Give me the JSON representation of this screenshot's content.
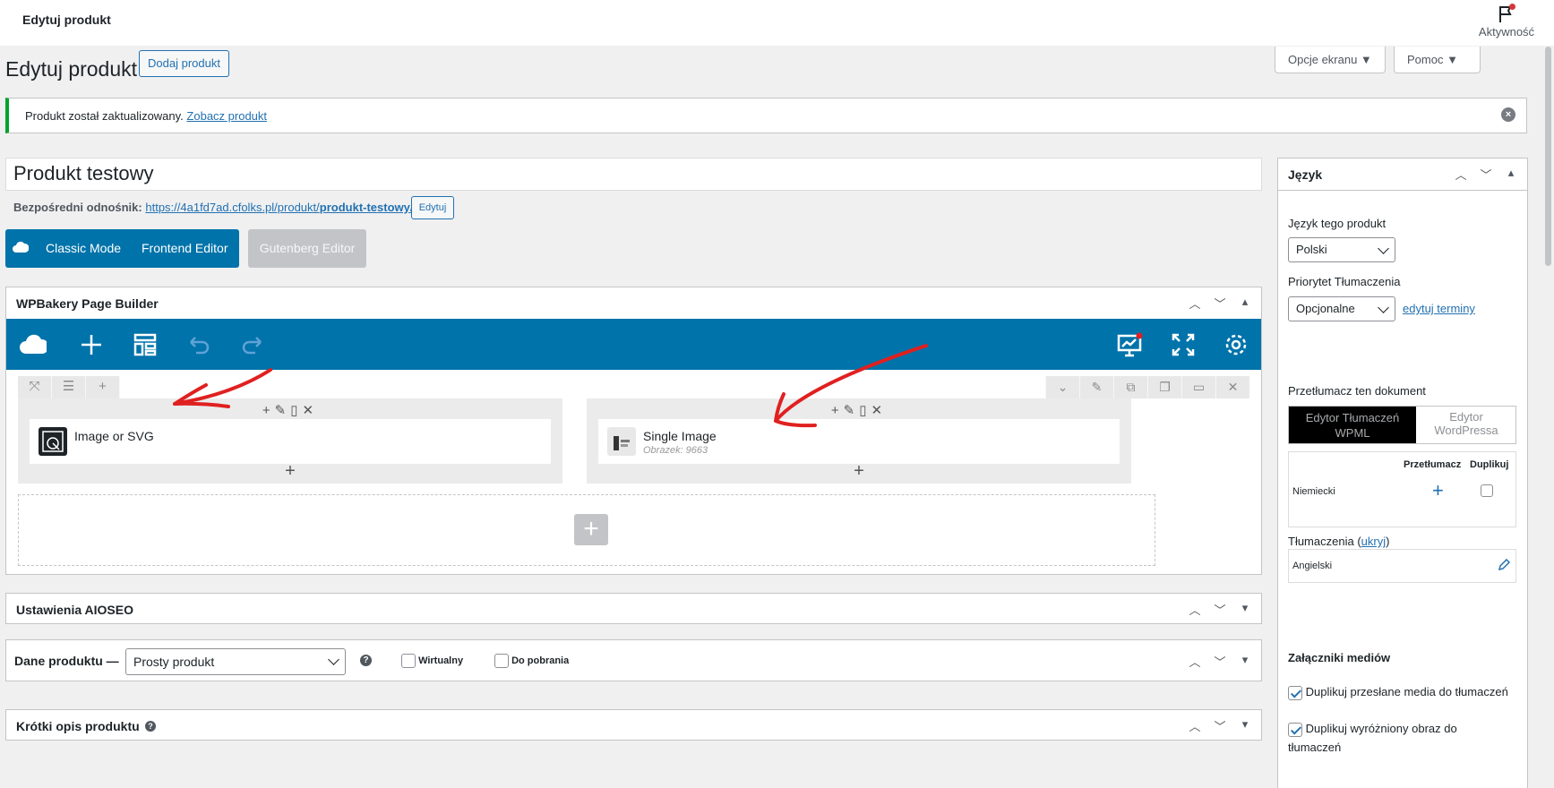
{
  "topbar": {
    "title": "Edytuj produkt",
    "activity_label": "Aktywność"
  },
  "header": {
    "title": "Edytuj produkt",
    "add_button": "Dodaj produkt",
    "screen_options": "Opcje ekranu ▼",
    "help": "Pomoc ▼"
  },
  "notice": {
    "text": "Produkt został zaktualizowany.",
    "link": "Zobacz produkt"
  },
  "post": {
    "title": "Produkt testowy",
    "permalink_label": "Bezpośredni odnośnik:",
    "permalink_base": "https://4a1fd7ad.cfolks.pl/produkt/",
    "permalink_slug": "produkt-testowy",
    "permalink_end": "/",
    "edit_button": "Edytuj"
  },
  "editors": {
    "classic": "Classic Mode",
    "frontend": "Frontend Editor",
    "gutenberg": "Gutenberg Editor"
  },
  "wpbakery": {
    "title": "WPBakery Page Builder",
    "columns": [
      {
        "element": "Image or SVG",
        "sub": ""
      },
      {
        "element": "Single Image",
        "sub": "Obrazek: 9663"
      }
    ]
  },
  "aioseo": {
    "title": "Ustawienia AIOSEO"
  },
  "product_data": {
    "title": "Dane produktu —",
    "type": "Prosty produkt",
    "virtual": "Wirtualny",
    "download": "Do pobrania"
  },
  "short_desc": {
    "title": "Krótki opis produktu"
  },
  "sidebar": {
    "title": "Język",
    "lang_label": "Język tego produkt",
    "lang_value": "Polski",
    "priority_label": "Priorytet Tłumaczenia",
    "priority_value": "Opcjonalne",
    "edit_terms": "edytuj terminy",
    "translate_label": "Przetłumacz ten dokument",
    "tab_wpml": "Edytor Tłumaczeń WPML",
    "tab_wp": "Edytor WordPressa",
    "col_translator": "Przetłumacz",
    "col_duplicate": "Duplikuj",
    "lang_row": "Niemiecki",
    "translations_label": "Tłumaczenia",
    "hide_link": "ukryj",
    "translation_row": "Angielski",
    "media_label": "Załączniki mediów",
    "media_opt1": "Duplikuj przesłane media do tłumaczeń",
    "media_opt2": "Duplikuj wyróżniony obraz do tłumaczeń"
  },
  "colors": {
    "wp_blue": "#2271b1",
    "wpb_blue": "#0073aa",
    "notice_green": "#00a32a",
    "arrow_red": "#e02020"
  }
}
